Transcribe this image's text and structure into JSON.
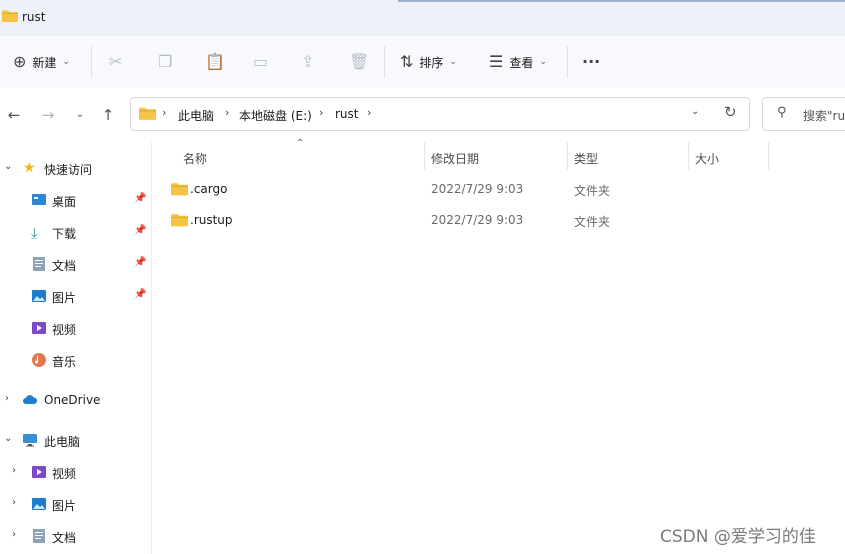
{
  "window": {
    "title": "rust"
  },
  "toolbar": {
    "new_label": "新建",
    "sort_label": "排序",
    "view_label": "查看",
    "more_glyph": "···"
  },
  "address": {
    "crumbs": [
      "此电脑",
      "本地磁盘 (E:)",
      "rust"
    ]
  },
  "search": {
    "placeholder": "搜索\"ru"
  },
  "sidebar": {
    "quick_access": "快速访问",
    "items": [
      {
        "label": "桌面",
        "pinned": true
      },
      {
        "label": "下载",
        "pinned": true
      },
      {
        "label": "文档",
        "pinned": true
      },
      {
        "label": "图片",
        "pinned": true
      },
      {
        "label": "视频",
        "pinned": false
      },
      {
        "label": "音乐",
        "pinned": false
      }
    ],
    "onedrive": "OneDrive",
    "this_pc": "此电脑",
    "pc_items": [
      {
        "label": "视频"
      },
      {
        "label": "图片"
      },
      {
        "label": "文档"
      }
    ]
  },
  "columns": {
    "name": "名称",
    "modified": "修改日期",
    "type": "类型",
    "size": "大小"
  },
  "files": [
    {
      "name": ".cargo",
      "modified": "2022/7/29 9:03",
      "type": "文件夹"
    },
    {
      "name": ".rustup",
      "modified": "2022/7/29 9:03",
      "type": "文件夹"
    }
  ],
  "watermark": "CSDN @爱学习的佳",
  "colors": {
    "folder": "#f6c445",
    "folder_dark": "#e0a92b",
    "accent": "#0067c0"
  }
}
